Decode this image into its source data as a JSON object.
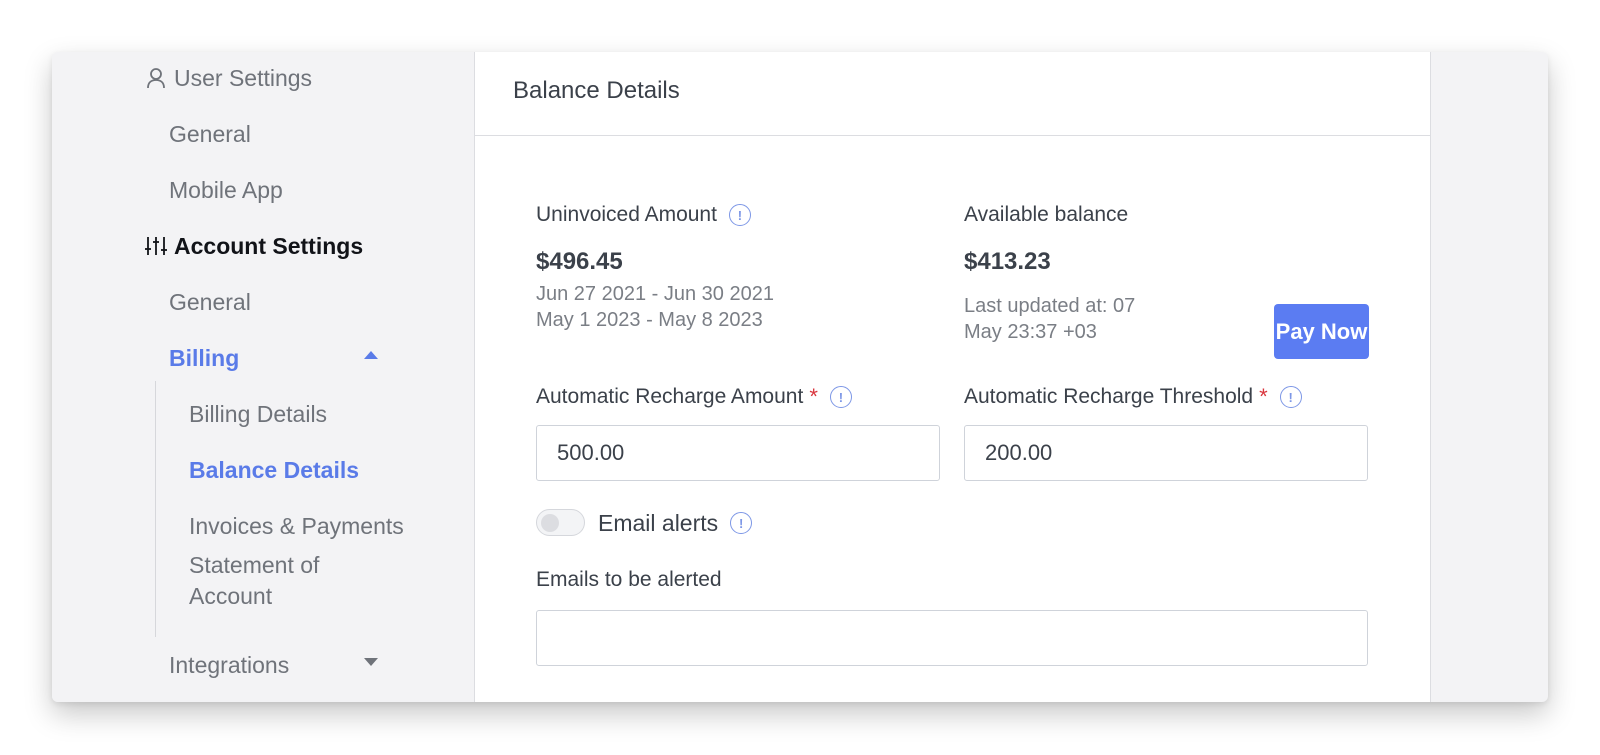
{
  "sidebar": {
    "user_settings": {
      "label": "User Settings",
      "icon": "user-icon"
    },
    "user_items": [
      "General",
      "Mobile App"
    ],
    "account_settings": {
      "label": "Account Settings",
      "icon": "sliders-icon"
    },
    "account_general": "General",
    "billing": {
      "label": "Billing",
      "expanded": true
    },
    "billing_items": [
      "Billing Details",
      "Balance Details",
      "Invoices & Payments",
      "Statement of Account"
    ],
    "active_item": "Balance Details",
    "integrations": {
      "label": "Integrations",
      "expanded": false
    }
  },
  "panel": {
    "title": "Balance Details",
    "uninvoiced": {
      "label": "Uninvoiced Amount",
      "amount": "$496.45",
      "ranges": [
        "Jun 27 2021 - Jun 30 2021",
        "May 1 2023 - May 8 2023"
      ]
    },
    "available": {
      "label": "Available balance",
      "amount": "$413.23",
      "updated_line1": "Last updated at: 07",
      "updated_line2": "May 23:37 +03"
    },
    "pay_now": "Pay Now",
    "recharge_amount": {
      "label": "Automatic Recharge Amount",
      "required": "*",
      "value": "500.00"
    },
    "recharge_threshold": {
      "label": "Automatic Recharge Threshold",
      "required": "*",
      "value": "200.00"
    },
    "email_alerts": {
      "label": "Email alerts",
      "enabled": false
    },
    "emails_label": "Emails to be alerted",
    "emails_value": ""
  },
  "colors": {
    "accent": "#5b7cf2",
    "active_text": "#5a7be8",
    "required": "#d9363e"
  }
}
